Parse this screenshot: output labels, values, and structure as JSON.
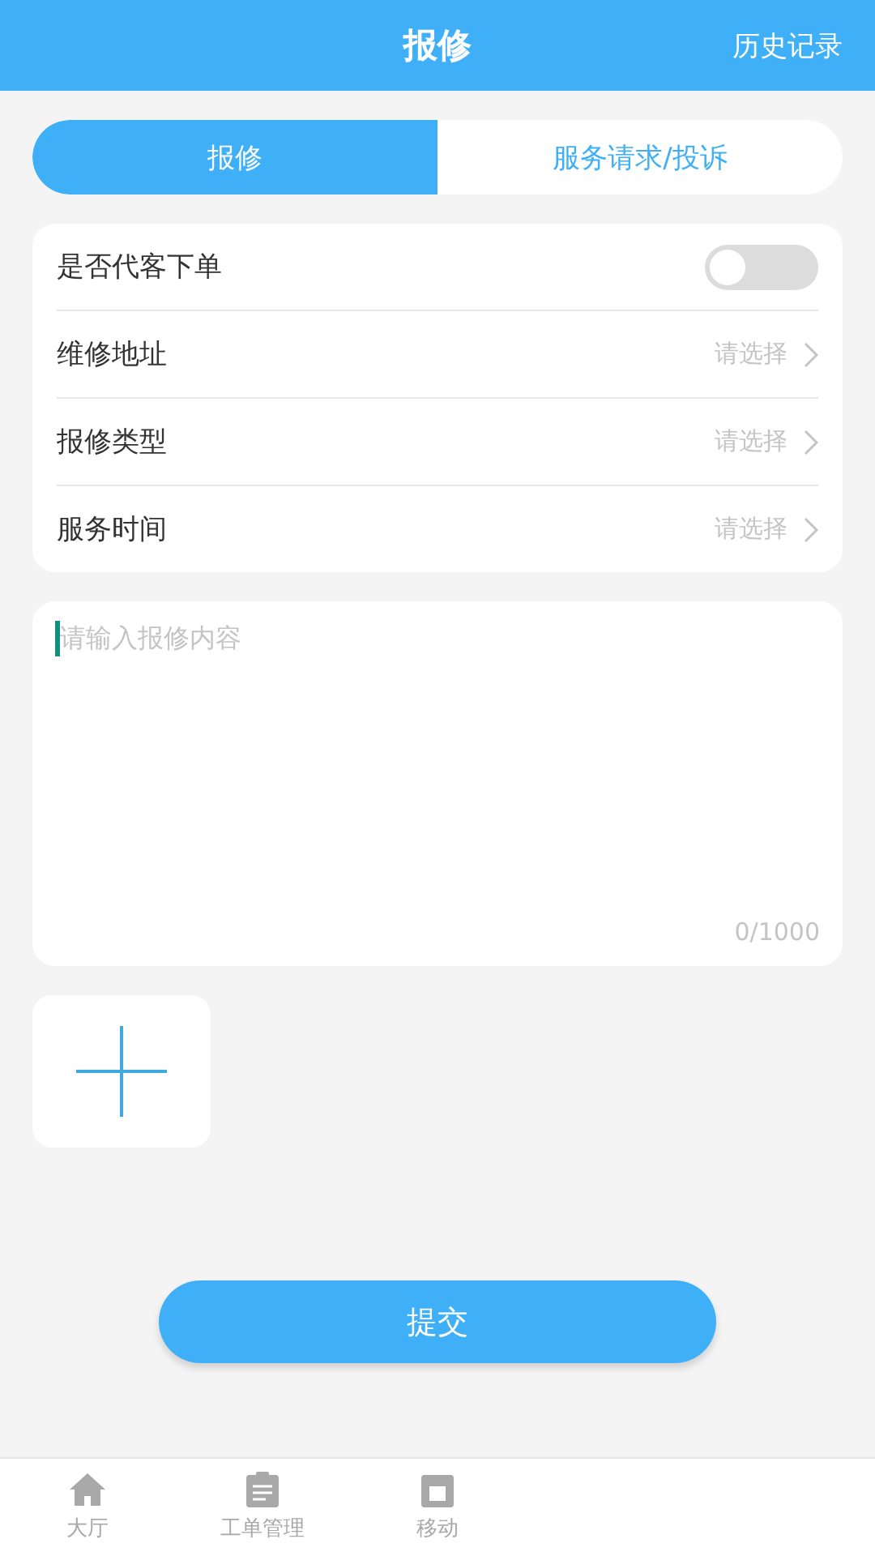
{
  "header": {
    "title": "报修",
    "action": "历史记录"
  },
  "segments": [
    {
      "label": "报修",
      "selected": true
    },
    {
      "label": "服务请求/投诉",
      "selected": false
    }
  ],
  "form_rows": [
    {
      "kind": "toggle",
      "label": "是否代客下单",
      "on": false
    },
    {
      "kind": "select",
      "label": "维修地址",
      "placeholder": "请选择"
    },
    {
      "kind": "select",
      "label": "报修类型",
      "placeholder": "请选择"
    },
    {
      "kind": "select",
      "label": "服务时间",
      "placeholder": "请选择"
    }
  ],
  "content": {
    "placeholder": "请输入报修内容",
    "focused": true,
    "counter": "0/1000"
  },
  "submit": "提交",
  "tab_bar": [
    {
      "kind": "home",
      "label": "大厅",
      "selected": false
    },
    {
      "kind": "clipboard",
      "label": "工单管理",
      "selected": false
    },
    {
      "kind": "calendar",
      "label": "移动",
      "selected": false
    }
  ]
}
